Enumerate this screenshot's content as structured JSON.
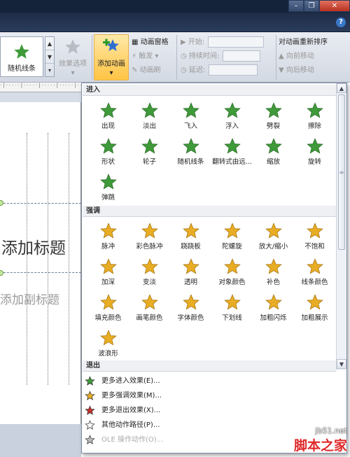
{
  "window": {
    "minimize_glyph": "–",
    "restore_glyph": "❐",
    "close_glyph": "✕",
    "help_glyph": "?"
  },
  "ribbon": {
    "gallery_selected_label": "随机线条",
    "effect_options_label": "效果选项",
    "add_animation_label": "添加动画",
    "add_animation_arrow": "▾",
    "animation_pane_label": "动画窗格",
    "trigger_label": "触发",
    "trigger_arrow": "▾",
    "animation_painter_label": "动画刷",
    "start_label": "开始:",
    "duration_label": "持续时间:",
    "delay_label": "延迟:",
    "reorder_title": "对动画重新排序",
    "move_earlier_label": "向前移动",
    "move_later_label": "向后移动"
  },
  "dropdown": {
    "sections": [
      {
        "title": "进入",
        "effects": [
          "出现",
          "淡出",
          "飞入",
          "浮入",
          "劈裂",
          "擦除",
          "形状",
          "轮子",
          "随机线条",
          "翻转式由远...",
          "缩放",
          "旋转",
          "弹跳"
        ]
      },
      {
        "title": "强调",
        "effects": [
          "脉冲",
          "彩色脉冲",
          "跷跷板",
          "陀螺旋",
          "放大/缩小",
          "不饱和",
          "加深",
          "变淡",
          "透明",
          "对象颜色",
          "补色",
          "线条颜色",
          "填充颜色",
          "画笔颜色",
          "字体颜色",
          "下划线",
          "加粗闪烁",
          "加粗展示",
          "波浪形"
        ]
      },
      {
        "title": "退出",
        "effects": []
      }
    ],
    "more_items": [
      {
        "label": "更多进入效果(E)...",
        "icon": "green-star-icon",
        "disabled": false
      },
      {
        "label": "更多强调效果(M)...",
        "icon": "gold-star-icon",
        "disabled": false
      },
      {
        "label": "更多退出效果(X)...",
        "icon": "red-star-icon",
        "disabled": false
      },
      {
        "label": "其他动作路径(P)...",
        "icon": "outline-star-icon",
        "disabled": false
      },
      {
        "label": "OLE 操作动作(O)...",
        "icon": "gear-icon",
        "disabled": true
      }
    ]
  },
  "slide": {
    "title_placeholder": "添加标题",
    "subtitle_placeholder": "添加副标题"
  },
  "watermark": {
    "site": "jb51.net",
    "name": "脚本之家"
  },
  "colors": {
    "entrance": "#3f9a3a",
    "emphasis": "#e8ad24",
    "exit": "#c9302c",
    "highlight": "#ffd26a"
  }
}
